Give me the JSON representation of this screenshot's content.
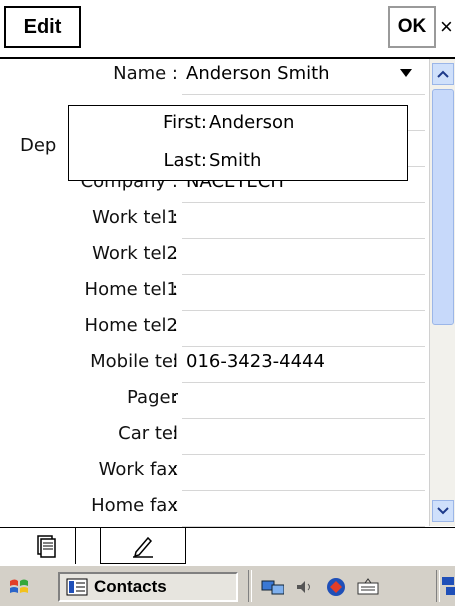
{
  "titlebar": {
    "edit_label": "Edit",
    "ok_label": "OK",
    "close_label": "×"
  },
  "form": {
    "name": {
      "label": "Name :",
      "value": "Anderson  Smith"
    },
    "department": {
      "label": "Dep"
    },
    "company": {
      "label": "Company :",
      "value": "NACETECH"
    },
    "fields": [
      {
        "label": "Work tel1",
        "value": ""
      },
      {
        "label": "Work tel2",
        "value": ""
      },
      {
        "label": "Home tel1",
        "value": ""
      },
      {
        "label": "Home tel2",
        "value": ""
      },
      {
        "label": "Mobile tel",
        "value": "016-3423-4444"
      },
      {
        "label": "Pager",
        "value": ""
      },
      {
        "label": "Car tel",
        "value": ""
      },
      {
        "label": "Work fax",
        "value": ""
      },
      {
        "label": "Home fax",
        "value": ""
      }
    ]
  },
  "name_popup": {
    "first_label": "First:",
    "first_value": "Anderson",
    "last_label": "Last:",
    "last_value": "Smith"
  },
  "taskbar": {
    "app_label": "Contacts",
    "icons": [
      "start-icon",
      "contacts-app-icon",
      "network-icon",
      "volume-icon",
      "sync-icon",
      "keyboard-icon",
      "connectivity-icon"
    ]
  },
  "tabs": [
    "summary-tab-icon",
    "notes-tab-icon"
  ],
  "colors": {
    "scrollbar": "#c7d9fa",
    "taskbar": "#d4d0c8"
  }
}
